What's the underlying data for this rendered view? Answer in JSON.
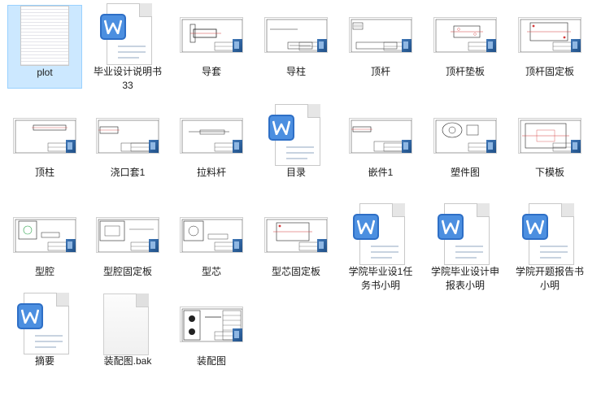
{
  "files": [
    {
      "name": "plot",
      "type": "text",
      "selected": true
    },
    {
      "name": "毕业设计说明书33",
      "type": "word"
    },
    {
      "name": "导套",
      "type": "cad",
      "variant": "daotao"
    },
    {
      "name": "导柱",
      "type": "cad",
      "variant": "daozhu"
    },
    {
      "name": "顶杆",
      "type": "cad",
      "variant": "dinggan"
    },
    {
      "name": "顶杆垫板",
      "type": "cad",
      "variant": "redbox"
    },
    {
      "name": "顶杆固定板",
      "type": "cad",
      "variant": "redbox2"
    },
    {
      "name": "顶柱",
      "type": "cad",
      "variant": "rod"
    },
    {
      "name": "浇口套1",
      "type": "cad",
      "variant": "rod2"
    },
    {
      "name": "拉料杆",
      "type": "cad",
      "variant": "rod3"
    },
    {
      "name": "目录",
      "type": "word"
    },
    {
      "name": "嵌件1",
      "type": "cad",
      "variant": "rod4"
    },
    {
      "name": "塑件图",
      "type": "cad",
      "variant": "parts"
    },
    {
      "name": "下模板",
      "type": "cad",
      "variant": "plate"
    },
    {
      "name": "型腔",
      "type": "cad",
      "variant": "cavity"
    },
    {
      "name": "型腔固定板",
      "type": "cad",
      "variant": "cavity2"
    },
    {
      "name": "型芯",
      "type": "cad",
      "variant": "core"
    },
    {
      "name": "型芯固定板",
      "type": "cad",
      "variant": "core2"
    },
    {
      "name": "学院毕业设1任务书小明",
      "type": "word"
    },
    {
      "name": "学院毕业设计申报表小明",
      "type": "word"
    },
    {
      "name": "学院开题报告书小明",
      "type": "word"
    },
    {
      "name": "摘要",
      "type": "word"
    },
    {
      "name": "装配图.bak",
      "type": "blank"
    },
    {
      "name": "装配图",
      "type": "cad",
      "variant": "assembly"
    }
  ],
  "colors": {
    "word_badge": "#4c8fe0",
    "selection": "#cce8ff",
    "cad_red": "#d43b3b",
    "cad_green": "#2aa24a"
  }
}
